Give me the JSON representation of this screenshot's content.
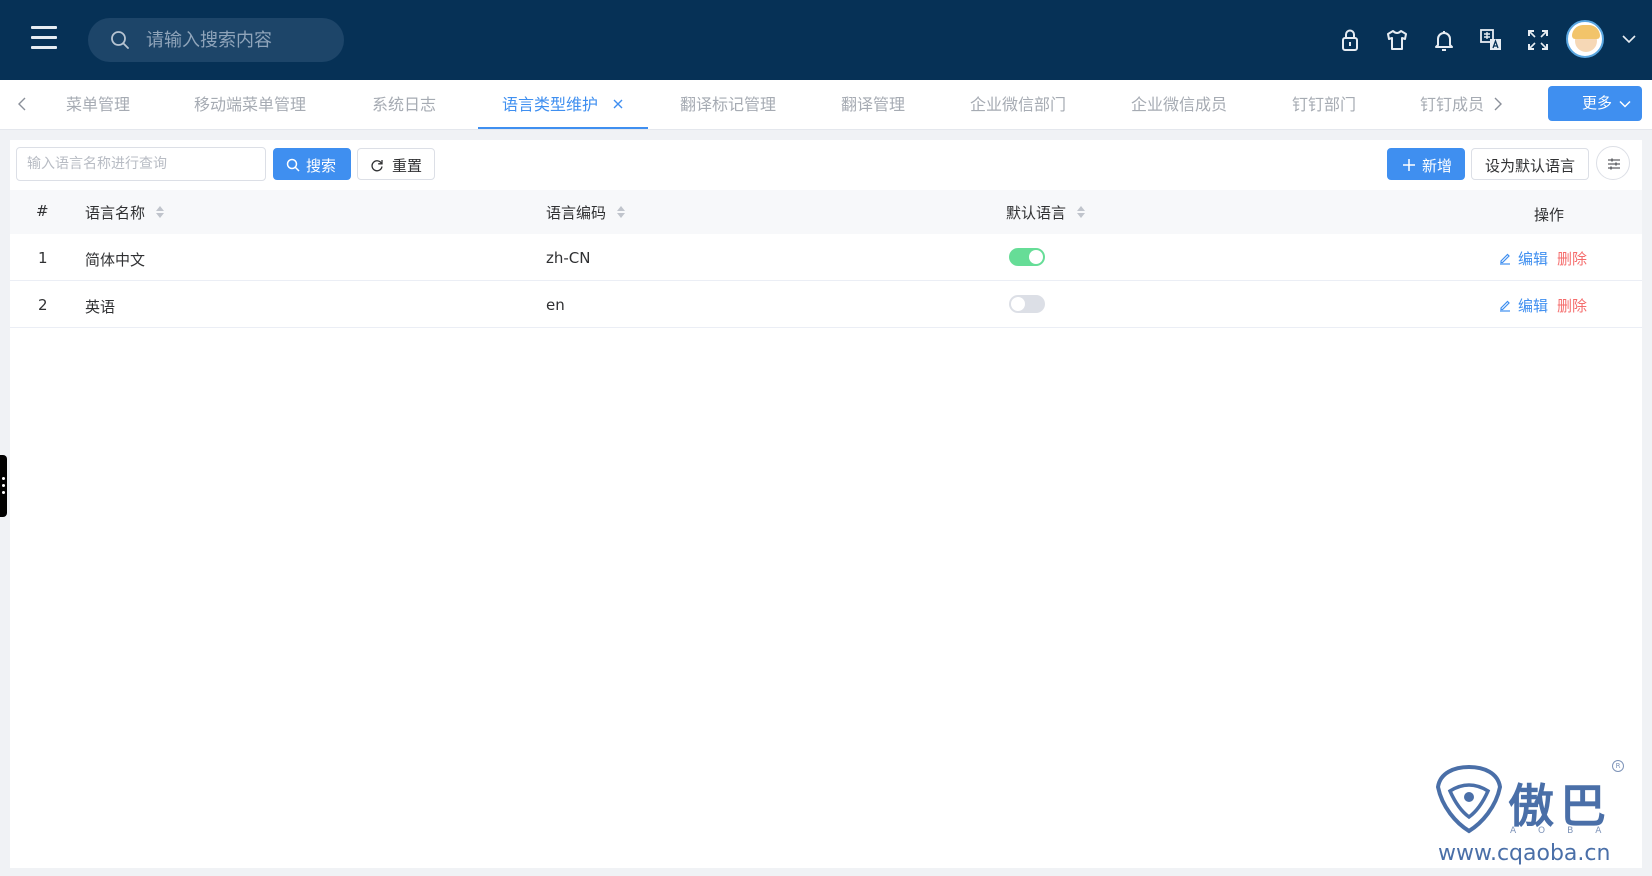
{
  "header": {
    "search_placeholder": "请输入搜索内容",
    "icons": [
      "lock-icon",
      "skin-icon",
      "bell-icon",
      "translate-icon",
      "fullscreen-icon",
      "avatar",
      "chevron-down-icon"
    ]
  },
  "tabs": {
    "items": [
      {
        "label": "菜单管理",
        "active": false
      },
      {
        "label": "移动端菜单管理",
        "active": false
      },
      {
        "label": "系统日志",
        "active": false
      },
      {
        "label": "语言类型维护",
        "active": true
      },
      {
        "label": "翻译标记管理",
        "active": false
      },
      {
        "label": "翻译管理",
        "active": false
      },
      {
        "label": "企业微信部门",
        "active": false
      },
      {
        "label": "企业微信成员",
        "active": false
      },
      {
        "label": "钉钉部门",
        "active": false
      },
      {
        "label": "钉钉成员",
        "active": false
      }
    ],
    "more_label": "更多"
  },
  "toolbar": {
    "query_placeholder": "输入语言名称进行查询",
    "search_label": "搜索",
    "reset_label": "重置",
    "add_label": "新增",
    "set_default_label": "设为默认语言"
  },
  "table": {
    "columns": [
      "#",
      "语言名称",
      "语言编码",
      "默认语言",
      "操作"
    ],
    "rows": [
      {
        "index": "1",
        "name": "简体中文",
        "code": "zh-CN",
        "is_default": true,
        "edit": "编辑",
        "delete": "删除"
      },
      {
        "index": "2",
        "name": "英语",
        "code": "en",
        "is_default": false,
        "edit": "编辑",
        "delete": "删除"
      }
    ]
  },
  "watermark": {
    "title": "傲巴",
    "subtitle": "AOBA",
    "url": "www.cqaoba.cn",
    "reg": "R"
  },
  "colors": {
    "header_bg": "#063156",
    "accent": "#3f8ff0",
    "danger": "#f56c6c",
    "switch_on": "#66dd97"
  }
}
